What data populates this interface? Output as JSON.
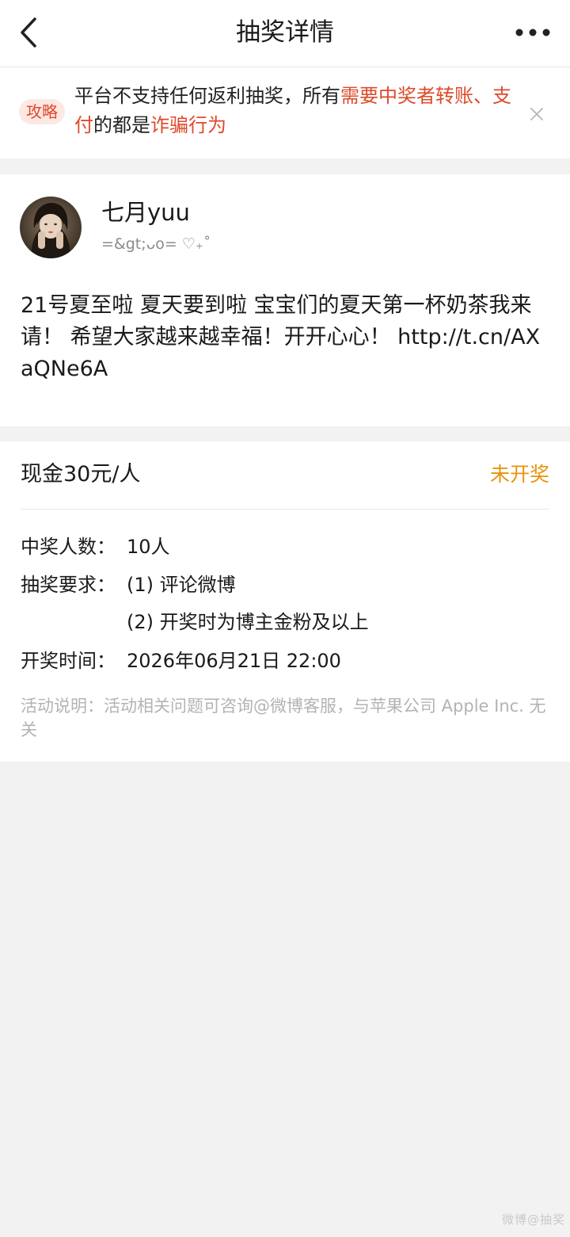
{
  "header": {
    "title": "抽奖详情"
  },
  "notice": {
    "tag": "攻略",
    "text_normal_1": "平台不支持任何返利抽奖，所有",
    "text_highlight_1": "需要中奖者转账、支付",
    "text_normal_2": "的都是",
    "text_highlight_2": "诈骗行为"
  },
  "post": {
    "username": "七月yuu",
    "subtitle": "=&gt;ᴗo= ♡₊˚",
    "text": "21号夏至啦 夏天要到啦 宝宝们的夏天第一杯奶茶我来请！ 希望大家越来越幸福！开开心心！ http://t.cn/AXaQNe6A"
  },
  "lottery": {
    "prize": "现金30元/人",
    "status": "未开奖",
    "winners_label": "中奖人数：",
    "winners_value": "10人",
    "requirements_label": "抽奖要求：",
    "requirement_1": "(1) 评论微博",
    "requirement_2": "(2) 开奖时为博主金粉及以上",
    "time_label": "开奖时间：",
    "time_value": "2026年06月21日 22:00",
    "disclaimer": "活动说明：活动相关问题可咨询@微博客服，与苹果公司 Apple Inc. 无关"
  },
  "watermark": "微博@抽奖",
  "colors": {
    "accent_red": "#dd4a2a",
    "status_orange": "#e8930d",
    "background": "#f2f2f2"
  },
  "icons": {
    "back": "chevron-left-icon",
    "more": "more-dots-icon",
    "close": "close-icon"
  }
}
